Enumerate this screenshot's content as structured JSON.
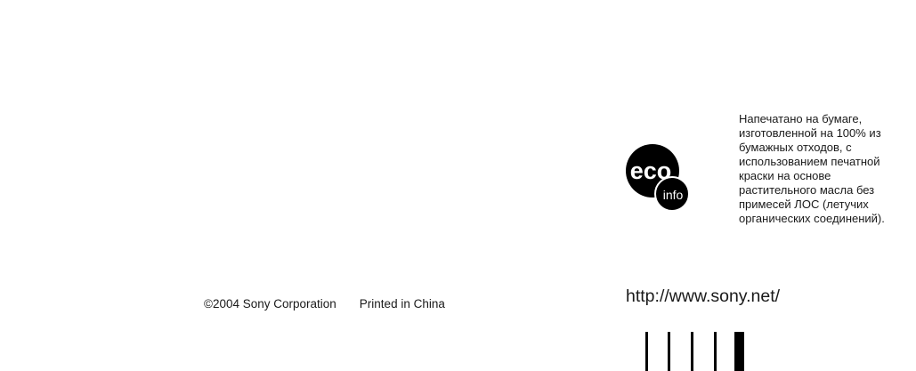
{
  "footer": {
    "copyright": "©2004 Sony Corporation",
    "printed": "Printed in China"
  },
  "eco_logo": {
    "icon": "eco-info-logo",
    "word": "eco",
    "sub": "info"
  },
  "eco_note": "Напечатано на бумаге,\nизготовленной на 100% из\nбумажных отходов, с\nиспользованием печатной\nкраски на основе\nрастительного масла без\nпримесей ЛОС (летучих\nорганических соединений).",
  "website": "http://www.sony.net/",
  "barcode": {
    "icon": "barcode-marks"
  }
}
